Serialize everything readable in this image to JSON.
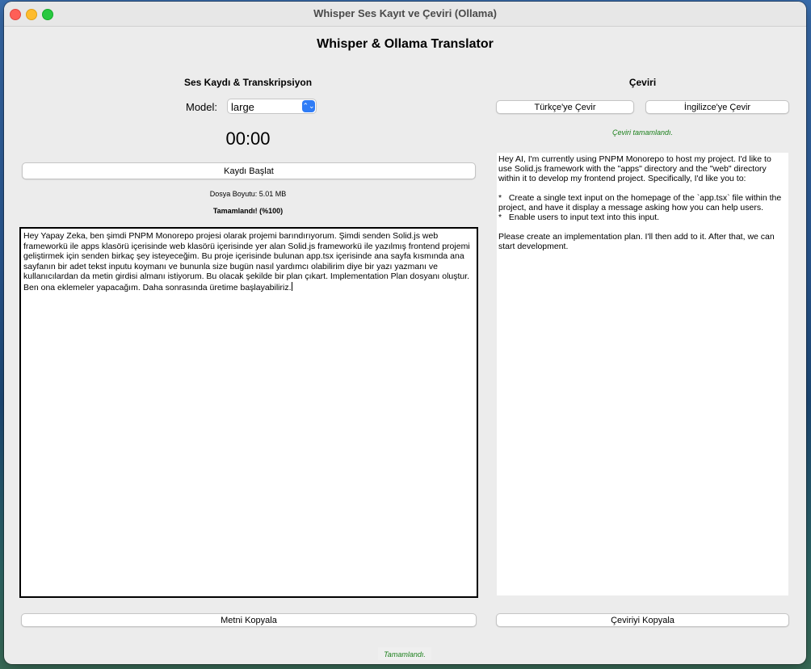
{
  "window": {
    "title": "Whisper Ses Kayıt ve Çeviri (Ollama)"
  },
  "app": {
    "title": "Whisper & Ollama Translator"
  },
  "left": {
    "section_title": "Ses Kaydı & Transkripsiyon",
    "model_label": "Model:",
    "model_value": "large",
    "timer": "00:00",
    "record_button": "Kaydı Başlat",
    "file_size": "Dosya Boyutu: 5.01 MB",
    "progress_status": "Tamamlandı! (%100)",
    "transcript": "Hey Yapay Zeka, ben şimdi PNPM Monorepo projesi olarak projemi barındırıyorum. Şimdi senden Solid.js web frameworkü ile apps klasörü içerisinde web klasörü içerisinde yer alan Solid.js frameworkü ile yazılmış frontend projemi geliştirmek için senden birkaç şey isteyeceğim. Bu proje içerisinde bulunan app.tsx içerisinde ana sayfa kısmında ana sayfanın bir adet tekst inputu koymanı ve bununla size bugün nasıl yardımcı olabilirim diye bir yazı yazmanı ve kullanıcılardan da metin girdisi almanı istiyorum. Bu olacak şekilde bir plan çıkart. Implementation Plan dosyanı oluştur. Ben ona eklemeler yapacağım. Daha sonrasında üretime başlayabiliriz.",
    "copy_button": "Metni Kopyala"
  },
  "right": {
    "section_title": "Çeviri",
    "to_turkish_button": "Türkçe'ye Çevir",
    "to_english_button": "İngilizce'ye Çevir",
    "status": "Çeviri tamamlandı.",
    "translation": "Hey AI, I'm currently using PNPM Monorepo to host my project. I'd like to use Solid.js framework with the \"apps\" directory and the \"web\" directory within it to develop my frontend project. Specifically, I'd like you to:\n\n*   Create a single text input on the homepage of the `app.tsx` file within the project, and have it display a message asking how you can help users.\n*   Enable users to input text into this input.\n\nPlease create an implementation plan. I'll then add to it. After that, we can start development.",
    "copy_button": "Çeviriyi Kopyala"
  },
  "footer": {
    "status": "Tamamlandı."
  },
  "colors": {
    "accent": "#2f7cf6",
    "success": "#1a7f1a",
    "close": "#ff5f57",
    "minimize": "#febc2e",
    "maximize": "#28c840"
  },
  "icons": {
    "select_arrow": "chevron-updown-icon"
  }
}
